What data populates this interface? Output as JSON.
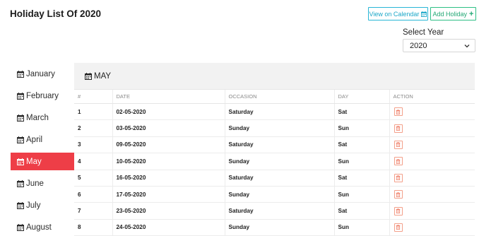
{
  "page": {
    "title": "Holiday List Of 2020"
  },
  "toolbar": {
    "calendar_label": "View on Calendar",
    "add_label": "Add Holiday"
  },
  "year_filter": {
    "label": "Select Year",
    "selected": "2020"
  },
  "months": [
    {
      "label": "January",
      "active": false
    },
    {
      "label": "February",
      "active": false
    },
    {
      "label": "March",
      "active": false
    },
    {
      "label": "April",
      "active": false
    },
    {
      "label": "May",
      "active": true
    },
    {
      "label": "June",
      "active": false
    },
    {
      "label": "July",
      "active": false
    },
    {
      "label": "August",
      "active": false
    }
  ],
  "panel": {
    "title": "MAY"
  },
  "table": {
    "headers": [
      "#",
      "DATE",
      "OCCASION",
      "DAY",
      "ACTION"
    ],
    "rows": [
      {
        "num": "1",
        "date": "02-05-2020",
        "occasion": "Saturday",
        "day": "Sat"
      },
      {
        "num": "2",
        "date": "03-05-2020",
        "occasion": "Sunday",
        "day": "Sun"
      },
      {
        "num": "3",
        "date": "09-05-2020",
        "occasion": "Saturday",
        "day": "Sat"
      },
      {
        "num": "4",
        "date": "10-05-2020",
        "occasion": "Sunday",
        "day": "Sun"
      },
      {
        "num": "5",
        "date": "16-05-2020",
        "occasion": "Saturday",
        "day": "Sat"
      },
      {
        "num": "6",
        "date": "17-05-2020",
        "occasion": "Sunday",
        "day": "Sun"
      },
      {
        "num": "7",
        "date": "23-05-2020",
        "occasion": "Saturday",
        "day": "Sat"
      },
      {
        "num": "8",
        "date": "24-05-2020",
        "occasion": "Sunday",
        "day": "Sun"
      }
    ]
  },
  "colors": {
    "active_month": "#ee3e47",
    "calendar_button": "#29b6d6",
    "add_button": "#2dbf85",
    "delete_icon": "#f0806a"
  },
  "icons": {
    "month": "calendar-icon",
    "calendar_button": "calendar-icon",
    "add_button": "plus-icon",
    "delete": "trash-icon",
    "select": "chevron-down-icon"
  }
}
